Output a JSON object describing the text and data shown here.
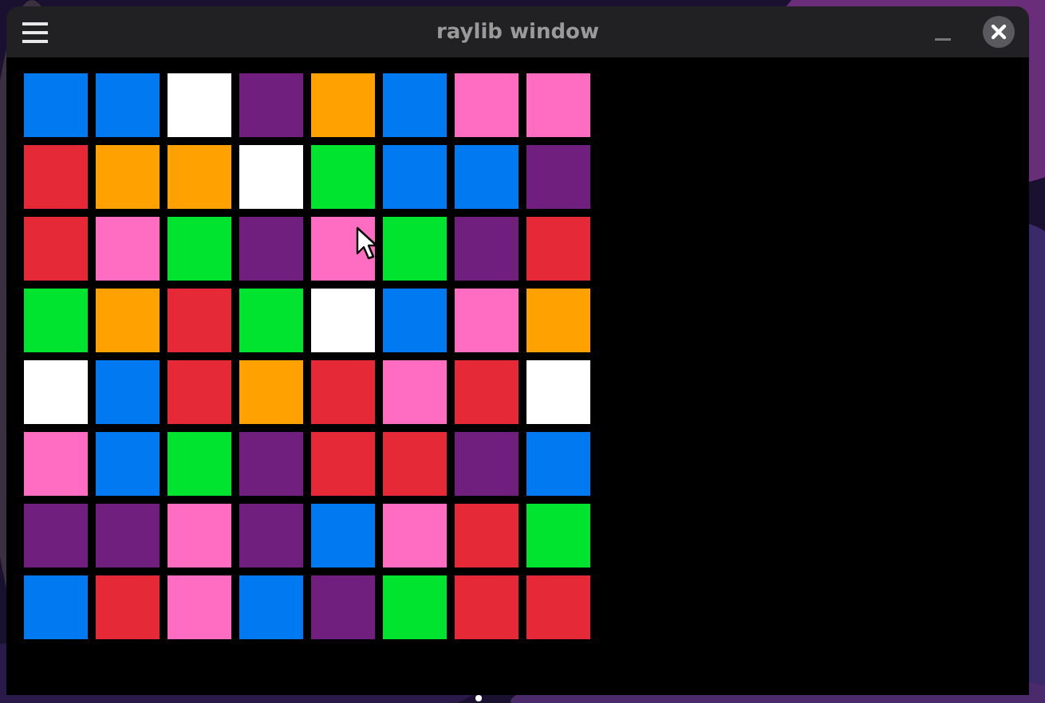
{
  "window": {
    "title": "raylib window"
  },
  "grid": [
    {
      "cells": [
        {
          "color": "#0079f1"
        },
        {
          "color": "#0079f1"
        },
        {
          "color": "#ffffff"
        },
        {
          "color": "#701f7e"
        },
        {
          "color": "#ffa100"
        },
        {
          "color": "#0079f1"
        },
        {
          "color": "#ff6dc2"
        },
        {
          "color": "#ff6dc2"
        }
      ]
    },
    {
      "cells": [
        {
          "color": "#e62937"
        },
        {
          "color": "#ffa100"
        },
        {
          "color": "#ffa100"
        },
        {
          "color": "#ffffff"
        },
        {
          "color": "#00e430"
        },
        {
          "color": "#0079f1"
        },
        {
          "color": "#0079f1"
        },
        {
          "color": "#701f7e"
        }
      ]
    },
    {
      "cells": [
        {
          "color": "#e62937"
        },
        {
          "color": "#ff6dc2"
        },
        {
          "color": "#00e430"
        },
        {
          "color": "#701f7e"
        },
        {
          "color": "#ff6dc2"
        },
        {
          "color": "#00e430"
        },
        {
          "color": "#701f7e"
        },
        {
          "color": "#e62937"
        }
      ]
    },
    {
      "cells": [
        {
          "color": "#00e430"
        },
        {
          "color": "#ffa100"
        },
        {
          "color": "#e62937"
        },
        {
          "color": "#00e430"
        },
        {
          "color": "#ffffff"
        },
        {
          "color": "#0079f1"
        },
        {
          "color": "#ff6dc2"
        },
        {
          "color": "#ffa100"
        }
      ]
    },
    {
      "cells": [
        {
          "color": "#ffffff"
        },
        {
          "color": "#0079f1"
        },
        {
          "color": "#e62937"
        },
        {
          "color": "#ffa100"
        },
        {
          "color": "#e62937"
        },
        {
          "color": "#ff6dc2"
        },
        {
          "color": "#e62937"
        },
        {
          "color": "#ffffff"
        }
      ]
    },
    {
      "cells": [
        {
          "color": "#ff6dc2"
        },
        {
          "color": "#0079f1"
        },
        {
          "color": "#00e430"
        },
        {
          "color": "#701f7e"
        },
        {
          "color": "#e62937"
        },
        {
          "color": "#e62937"
        },
        {
          "color": "#701f7e"
        },
        {
          "color": "#0079f1"
        }
      ]
    },
    {
      "cells": [
        {
          "color": "#701f7e"
        },
        {
          "color": "#701f7e"
        },
        {
          "color": "#ff6dc2"
        },
        {
          "color": "#701f7e"
        },
        {
          "color": "#0079f1"
        },
        {
          "color": "#ff6dc2"
        },
        {
          "color": "#e62937"
        },
        {
          "color": "#00e430"
        }
      ]
    },
    {
      "cells": [
        {
          "color": "#0079f1"
        },
        {
          "color": "#e62937"
        },
        {
          "color": "#ff6dc2"
        },
        {
          "color": "#0079f1"
        },
        {
          "color": "#701f7e"
        },
        {
          "color": "#00e430"
        },
        {
          "color": "#e62937"
        },
        {
          "color": "#e62937"
        }
      ]
    }
  ]
}
